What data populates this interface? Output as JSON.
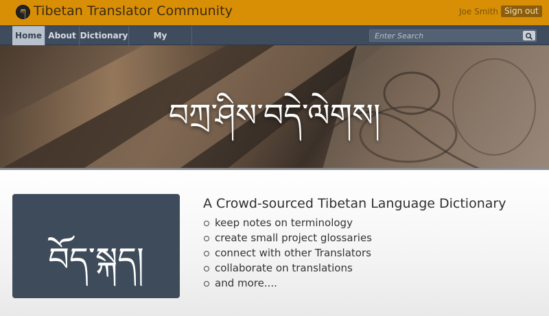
{
  "header": {
    "site_title": "Tibetan Translator Community",
    "logo_glyph": "ཀ",
    "user_name": "Joe Smith",
    "signout_label": "Sign out",
    "brand_color": "#d88f06"
  },
  "nav": {
    "items": [
      {
        "label": "Home",
        "active": true
      },
      {
        "label": "About",
        "active": false
      },
      {
        "label": "Dictionary",
        "active": false
      },
      {
        "label": "My Glossaries",
        "active": false
      }
    ],
    "search_placeholder": "Enter Search",
    "search_icon": "search-icon"
  },
  "hero": {
    "tibetan_text": "བཀྲ་ཤིས་བདེ་ལེགས།"
  },
  "main": {
    "card_text": "བོད་སྐད།",
    "tagline": "A Crowd-sourced Tibetan Language Dictionary",
    "features": [
      "keep notes on terminology",
      "create small project glossaries",
      "connect with other Translators",
      "collaborate on translations",
      "and more...."
    ]
  }
}
